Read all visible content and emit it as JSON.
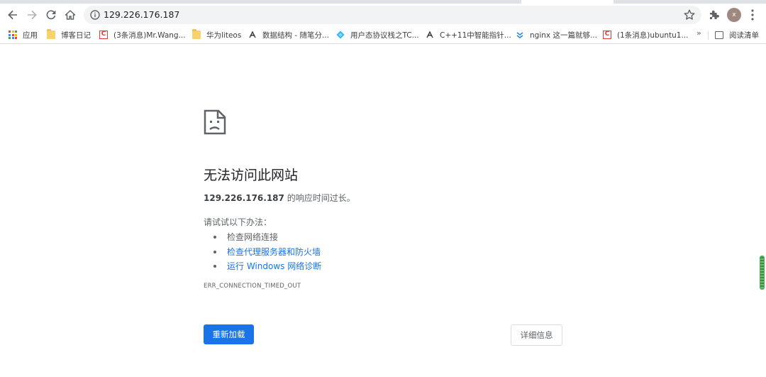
{
  "browser": {
    "url": "129.226.176.187",
    "avatar_letter": "x",
    "icons": {
      "back": "arrow-left-icon",
      "forward": "arrow-right-icon",
      "reload": "reload-icon",
      "home": "home-icon",
      "site_info": "info-icon",
      "bookmark_star": "star-icon",
      "extensions": "puzzle-icon",
      "menu": "more-vert-icon"
    }
  },
  "bookmarks": {
    "items": [
      {
        "label": "应用",
        "icon": "apps-grid-icon"
      },
      {
        "label": "博客日记",
        "icon": "folder-icon"
      },
      {
        "label": "(3条消息)Mr.Wang...",
        "icon": "csdn-icon"
      },
      {
        "label": "华为liteos",
        "icon": "folder-icon"
      },
      {
        "label": "数据结构 - 随笔分...",
        "icon": "cnblogs-icon"
      },
      {
        "label": "用户态协议栈之TC...",
        "icon": "diamond-icon"
      },
      {
        "label": "C++11中智能指针...",
        "icon": "cnblogs-icon"
      },
      {
        "label": "nginx 这一篇就够...",
        "icon": "chevrons-icon"
      },
      {
        "label": "(1条消息)ubuntu1...",
        "icon": "csdn-icon"
      }
    ],
    "more": "»",
    "reading_list": "阅读清单"
  },
  "error": {
    "title": "无法访问此网站",
    "host": "129.226.176.187",
    "message": " 的响应时间过长。",
    "suggest_label": "请试试以下办法：",
    "suggestions": [
      {
        "text": "检查网络连接",
        "link": false
      },
      {
        "text": "检查代理服务器和防火墙",
        "link": true
      },
      {
        "text": "运行 Windows 网络诊断",
        "link": true
      }
    ],
    "code": "ERR_CONNECTION_TIMED_OUT",
    "reload_label": "重新加载",
    "details_label": "详细信息"
  },
  "colors": {
    "accent": "#1a73e8",
    "text_secondary": "#5f6368",
    "omnibox_bg": "#f1f3f4"
  }
}
